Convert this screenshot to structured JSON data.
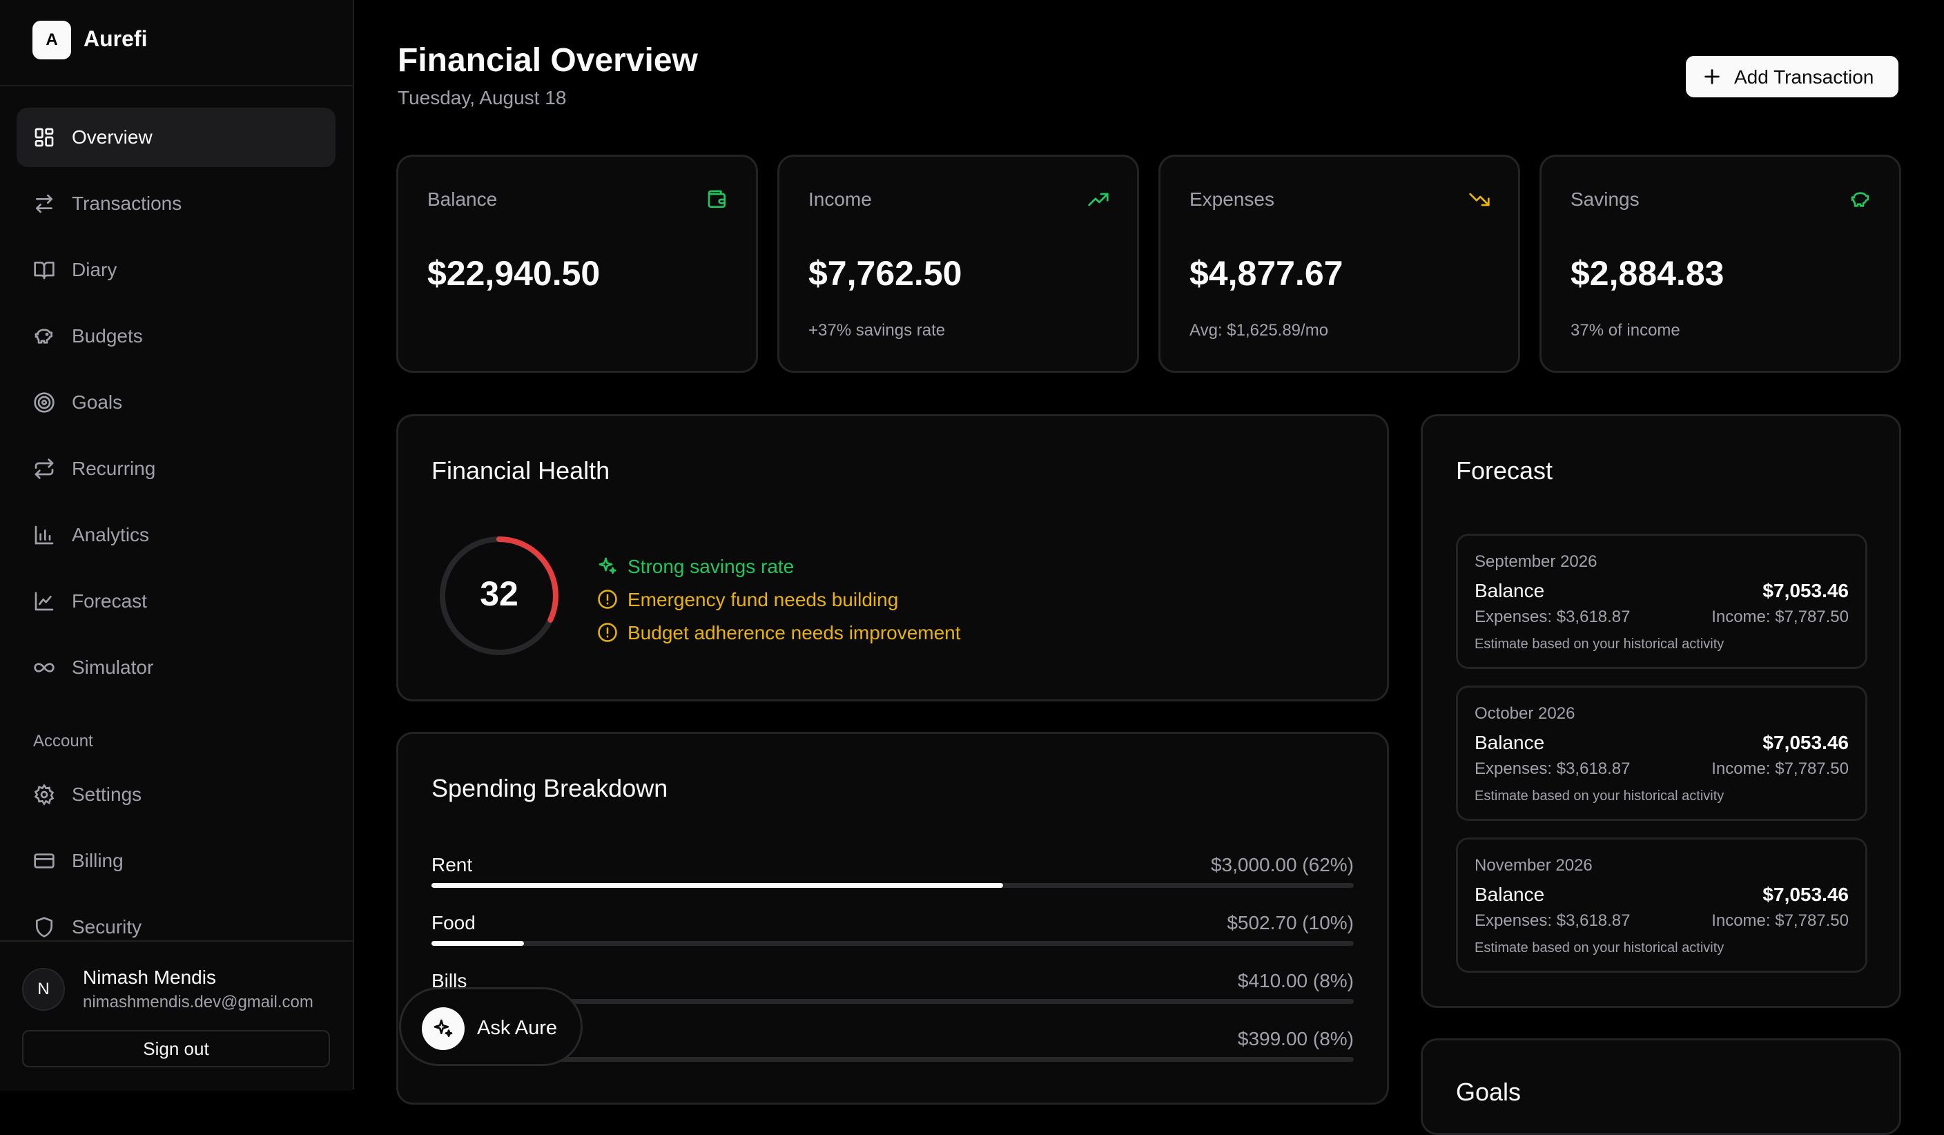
{
  "brand": {
    "logo_letter": "A",
    "name": "Aurefi"
  },
  "nav": {
    "items": [
      {
        "label": "Overview",
        "icon": "grid-icon",
        "active": true
      },
      {
        "label": "Transactions",
        "icon": "arrows-icon"
      },
      {
        "label": "Diary",
        "icon": "book-icon"
      },
      {
        "label": "Budgets",
        "icon": "piggy-bank-icon"
      },
      {
        "label": "Goals",
        "icon": "target-icon"
      },
      {
        "label": "Recurring",
        "icon": "repeat-icon"
      },
      {
        "label": "Analytics",
        "icon": "bar-chart-icon"
      },
      {
        "label": "Forecast",
        "icon": "line-chart-icon"
      },
      {
        "label": "Simulator",
        "icon": "infinity-icon"
      }
    ],
    "account_label": "Account",
    "account_items": [
      {
        "label": "Settings",
        "icon": "gear-icon"
      },
      {
        "label": "Billing",
        "icon": "credit-card-icon"
      },
      {
        "label": "Security",
        "icon": "shield-icon"
      }
    ]
  },
  "user": {
    "initial": "N",
    "name": "Nimash Mendis",
    "email": "nimashmendis.dev@gmail.com",
    "signout_label": "Sign out"
  },
  "header": {
    "title": "Financial Overview",
    "date": "Tuesday, August 18",
    "add_label": "Add Transaction"
  },
  "stats": {
    "balance": {
      "title": "Balance",
      "value": "$22,940.50",
      "sub": "",
      "icon": "wallet-icon",
      "color": "#22c55e"
    },
    "income": {
      "title": "Income",
      "value": "$7,762.50",
      "sub": "+37% savings rate",
      "icon": "trending-up-icon",
      "color": "#22c55e"
    },
    "expenses": {
      "title": "Expenses",
      "value": "$4,877.67",
      "sub": "Avg: $1,625.89/mo",
      "icon": "trending-down-icon",
      "color": "#eab308"
    },
    "savings": {
      "title": "Savings",
      "value": "$2,884.83",
      "sub": "37% of income",
      "icon": "piggy-bank-icon",
      "color": "#22c55e"
    }
  },
  "health": {
    "title": "Financial Health",
    "score": 32,
    "score_max": 100,
    "gauge_color": "#e53e3e",
    "items": [
      {
        "text": "Strong savings rate",
        "status": "good",
        "icon": "sparkles-icon"
      },
      {
        "text": "Emergency fund needs building",
        "status": "warn",
        "icon": "alert-circle-icon"
      },
      {
        "text": "Budget adherence needs improvement",
        "status": "warn",
        "icon": "alert-circle-icon"
      }
    ]
  },
  "spending": {
    "title": "Spending Breakdown",
    "items": [
      {
        "label": "Rent",
        "amount": "$3,000.00 (62%)",
        "percent": 62
      },
      {
        "label": "Food",
        "amount": "$502.70 (10%)",
        "percent": 10
      },
      {
        "label": "Bills",
        "amount": "$410.00 (8%)",
        "percent": 8
      },
      {
        "label": "",
        "amount": "$399.00 (8%)",
        "percent": 8
      }
    ]
  },
  "forecast": {
    "title": "Forecast",
    "items": [
      {
        "month": "September 2026",
        "balance_label": "Balance",
        "balance": "$7,053.46",
        "expenses": "Expenses: $3,618.87",
        "income": "Income: $7,787.50",
        "note": "Estimate based on your historical activity"
      },
      {
        "month": "October 2026",
        "balance_label": "Balance",
        "balance": "$7,053.46",
        "expenses": "Expenses: $3,618.87",
        "income": "Income: $7,787.50",
        "note": "Estimate based on your historical activity"
      },
      {
        "month": "November 2026",
        "balance_label": "Balance",
        "balance": "$7,053.46",
        "expenses": "Expenses: $3,618.87",
        "income": "Income: $7,787.50",
        "note": "Estimate based on your historical activity"
      }
    ]
  },
  "goals": {
    "title": "Goals"
  },
  "ask": {
    "label": "Ask Aure",
    "icon": "sparkles-icon"
  }
}
